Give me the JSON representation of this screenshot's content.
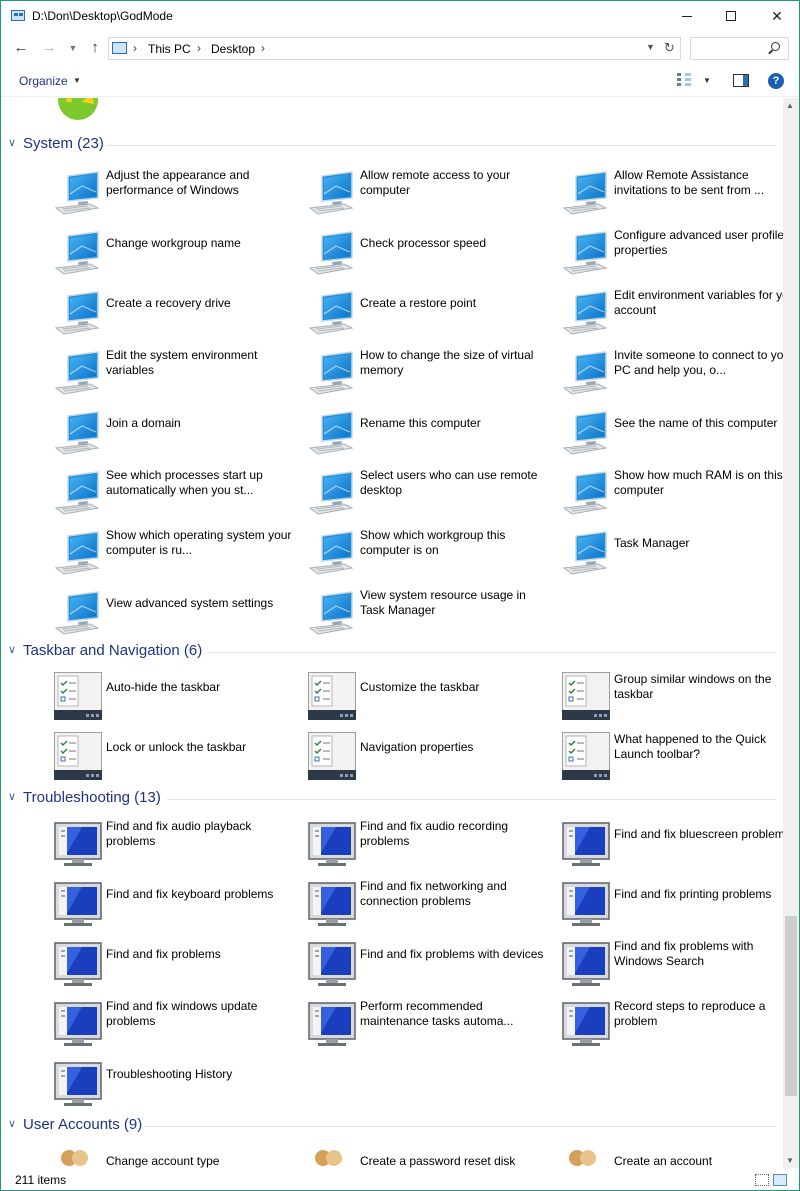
{
  "window": {
    "title": "D:\\Don\\Desktop\\GodMode"
  },
  "address": {
    "crumbs": [
      "This PC",
      "Desktop"
    ],
    "search_placeholder": ""
  },
  "toolbar": {
    "organize_label": "Organize"
  },
  "groups": [
    {
      "id": "system",
      "title": "System (23)",
      "icon": "monitor-icon",
      "items": [
        "Adjust the appearance and performance of Windows",
        "Allow remote access to your computer",
        "Allow Remote Assistance invitations to be sent from ...",
        "Change workgroup name",
        "Check processor speed",
        "Configure advanced user profile properties",
        "Create a recovery drive",
        "Create a restore point",
        "Edit environment variables for your account",
        "Edit the system environment variables",
        "How to change the size of virtual memory",
        "Invite someone to connect to your PC and help you, o...",
        "Join a domain",
        "Rename this computer",
        "See the name of this computer",
        "See which processes start up automatically when you st...",
        "Select users who can use remote desktop",
        "Show how much RAM is on this computer",
        "Show which operating system your computer is ru...",
        "Show which workgroup this computer is on",
        "Task Manager",
        "View advanced system settings",
        "View system resource usage in Task Manager"
      ]
    },
    {
      "id": "taskbar",
      "title": "Taskbar and Navigation (6)",
      "icon": "taskbar-checklist-icon",
      "items": [
        "Auto-hide the taskbar",
        "Customize the taskbar",
        "Group similar windows on the taskbar",
        "Lock or unlock the taskbar",
        "Navigation properties",
        "What happened to the Quick Launch toolbar?"
      ]
    },
    {
      "id": "troubleshooting",
      "title": "Troubleshooting (13)",
      "icon": "troubleshoot-monitor-icon",
      "items": [
        "Find and fix audio playback problems",
        "Find and fix audio recording problems",
        "Find and fix bluescreen problems",
        "Find and fix keyboard problems",
        "Find and fix networking and connection problems",
        "Find and fix printing problems",
        "Find and fix problems",
        "Find and fix problems with devices",
        "Find and fix problems with Windows Search",
        "Find and fix windows update problems",
        "Perform recommended maintenance tasks automa...",
        "Record steps to reproduce a problem",
        "Troubleshooting History"
      ]
    },
    {
      "id": "useraccounts",
      "title": "User Accounts (9)",
      "icon": "users-icon",
      "items": [
        "Change account type",
        "Create a password reset disk",
        "Create an account"
      ]
    }
  ],
  "status": {
    "count_text": "211 items"
  }
}
